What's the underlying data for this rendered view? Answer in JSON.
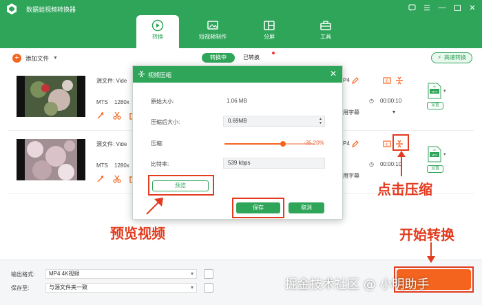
{
  "app": {
    "title": "数据蛙视频转换器"
  },
  "tabs": [
    {
      "label": "转换",
      "icon": "convert-icon",
      "active": true
    },
    {
      "label": "短视频制作",
      "icon": "short-video-icon",
      "active": false
    },
    {
      "label": "分屏",
      "icon": "split-screen-icon",
      "active": false
    },
    {
      "label": "工具",
      "icon": "toolbox-icon",
      "active": false
    }
  ],
  "toolbar": {
    "add_file": "添加文件",
    "converting": "转换中",
    "converted": "已转换",
    "high_speed": "高速转换"
  },
  "files": [
    {
      "source_label": "源文件: Vide",
      "format": "MTS",
      "resolution": "1280x",
      "out_format": "P4",
      "time": "00:00:10",
      "subtitle": "用字幕"
    },
    {
      "source_label": "源文件: Vide",
      "format": "MTS",
      "resolution": "1280x",
      "out_format": "P4",
      "time": "00:00:10",
      "subtitle": "用字幕"
    }
  ],
  "format_badge": {
    "top": "4K",
    "bottom": "MP4",
    "settings": "设置"
  },
  "bottom": {
    "output_format_label": "输出格式:",
    "output_format_value": "MP4 4K视频",
    "save_to_label": "保存至:",
    "save_to_value": "与源文件夹一致"
  },
  "dialog": {
    "title": "视频压缩",
    "original_size_label": "原始大小:",
    "original_size": "1.06 MB",
    "compressed_size_label": "压缩后大小:",
    "compressed_size": "0.69MB",
    "compress_label": "压缩:",
    "compress_percent": "-35.20%",
    "compress_level": 0.65,
    "bitrate_label": "比特率:",
    "bitrate": "539 kbps",
    "preview_btn": "预览",
    "save_btn": "保存",
    "cancel_btn": "取消"
  },
  "annotations": {
    "preview_video": "预览视频",
    "click_compress": "点击压缩",
    "start_convert": "开始转换"
  },
  "watermark": "掘金技术社区 @ 小明助手",
  "colors": {
    "brand": "#2fa55a",
    "accent": "#f5641e",
    "annotation": "#e23b1e"
  }
}
